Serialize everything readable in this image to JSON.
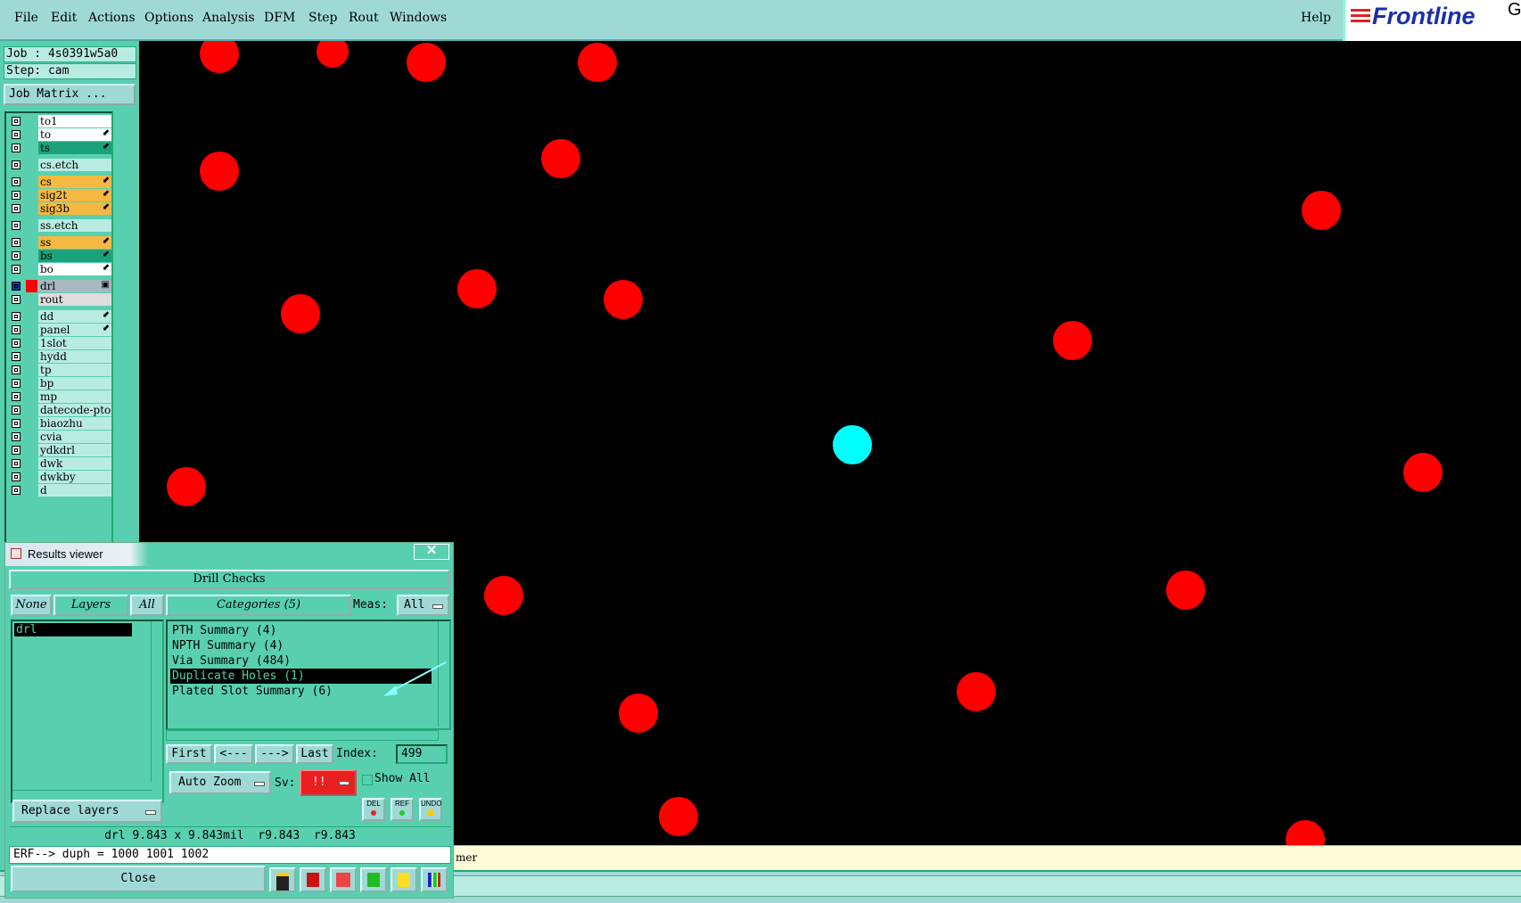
{
  "menu": [
    "File",
    "Edit",
    "Actions",
    "Options",
    "Analysis",
    "DFM",
    "Step",
    "Rout",
    "Windows"
  ],
  "help": "Help",
  "brand": {
    "name": "Frontline",
    "suffix": "Ge",
    "suffix2": "G"
  },
  "left": {
    "job": "Job : 4s0391w5a0",
    "step": "Step: cam",
    "job_matrix": "Job Matrix ...",
    "layers": [
      {
        "name": "to1",
        "color": "#ffffff",
        "marker": ""
      },
      {
        "name": "to",
        "color": "#ffffff",
        "marker": "⬋"
      },
      {
        "name": "ts",
        "color": "#1aa37a",
        "marker": "⬋"
      },
      {
        "name": "cs.etch",
        "color": "#b8ece2",
        "marker": ""
      },
      {
        "name": "cs",
        "color": "#f5b942",
        "marker": "⬋"
      },
      {
        "name": "sig2t",
        "color": "#f5b942",
        "marker": "⬋"
      },
      {
        "name": "sig3b",
        "color": "#f5b942",
        "marker": "⬋"
      },
      {
        "name": "ss.etch",
        "color": "#b8ece2",
        "marker": ""
      },
      {
        "name": "ss",
        "color": "#f5b942",
        "marker": "⬋"
      },
      {
        "name": "bs",
        "color": "#1aa37a",
        "marker": "⬋"
      },
      {
        "name": "bo",
        "color": "#ffffff",
        "marker": "⬋"
      },
      {
        "name": "drl",
        "color": "#a8b8c0",
        "marker": "▣"
      },
      {
        "name": "rout",
        "color": "#dddddd",
        "marker": ""
      },
      {
        "name": "dd",
        "color": "#b8ece2",
        "marker": "⬋"
      },
      {
        "name": "panel",
        "color": "#b8ece2",
        "marker": "⬋"
      },
      {
        "name": "1slot",
        "color": "#b8ece2",
        "marker": ""
      },
      {
        "name": "hydd",
        "color": "#b8ece2",
        "marker": ""
      },
      {
        "name": "tp",
        "color": "#b8ece2",
        "marker": ""
      },
      {
        "name": "bp",
        "color": "#b8ece2",
        "marker": ""
      },
      {
        "name": "mp",
        "color": "#b8ece2",
        "marker": ""
      },
      {
        "name": "datecode-pto",
        "color": "#b8ece2",
        "marker": ""
      },
      {
        "name": "biaozhu",
        "color": "#b8ece2",
        "marker": ""
      },
      {
        "name": "cvia",
        "color": "#b8ece2",
        "marker": ""
      },
      {
        "name": "ydkdrl",
        "color": "#b8ece2",
        "marker": ""
      },
      {
        "name": "dwk",
        "color": "#b8ece2",
        "marker": ""
      },
      {
        "name": "dwkby",
        "color": "#b8ece2",
        "marker": ""
      },
      {
        "name": "d",
        "color": "#b8ece2",
        "marker": ""
      }
    ]
  },
  "colors": {
    "pad": "#ff0000",
    "highlight": "#00ffff",
    "background": "#000000",
    "panel": "#58d0b0"
  },
  "results": {
    "title": "Results viewer",
    "close_x": "✕",
    "header": "Drill Checks",
    "none": "None",
    "layers": "Layers",
    "all": "All",
    "categories_btn": "Categories (5)",
    "meas_label": "Meas:",
    "meas_value": "All",
    "layer_items": [
      "drl"
    ],
    "categories": [
      "PTH Summary (4)",
      "NPTH Summary (4)",
      "Via Summary (484)",
      "Duplicate Holes (1)",
      "Plated Slot Summary (6)"
    ],
    "selected_category": "Duplicate Holes (1)",
    "first": "First",
    "prev": "<---",
    "next": "--->",
    "last": "Last",
    "index_label": "Index:",
    "index_value": "499",
    "auto_zoom": "Auto Zoom",
    "sv_label": "Sv:",
    "sv_value": "!!",
    "show_all": "Show All",
    "replace_layers": "Replace layers",
    "icons": [
      "DEL",
      "REF",
      "UNDO"
    ],
    "info_line": "drl 9.843 x 9.843mil  r9.843  r9.843",
    "erf_line": "ERF--> duph = 1000 1001 1002",
    "close": "Close"
  },
  "message": "mer"
}
